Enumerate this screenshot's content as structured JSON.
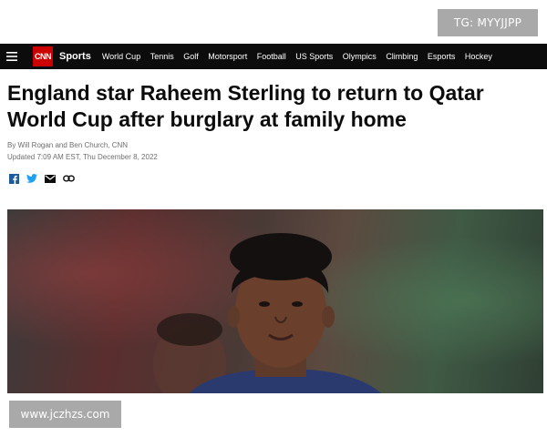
{
  "watermarks": {
    "top_right": "TG: MYYJJPP",
    "bottom_left": "www.jczhzs.com"
  },
  "nav": {
    "logo": "CNN",
    "section": "Sports",
    "links": [
      "World Cup",
      "Tennis",
      "Golf",
      "Motorsport",
      "Football",
      "US Sports",
      "Olympics",
      "Climbing",
      "Esports",
      "Hockey"
    ]
  },
  "article": {
    "headline": "England star Raheem Sterling to return to Qatar World Cup after burglary at family home",
    "byline": "By Will Rogan and Ben Church, CNN",
    "updated": "Updated 7:09 AM EST, Thu December 8, 2022"
  },
  "share_icons": [
    "facebook-icon",
    "twitter-icon",
    "email-icon",
    "link-icon"
  ],
  "colors": {
    "nav_bg": "#0c0c0c",
    "cnn_red": "#cc0000",
    "watermark_bg": "#a9a9a9",
    "share_blue": "#1c5b9c"
  }
}
